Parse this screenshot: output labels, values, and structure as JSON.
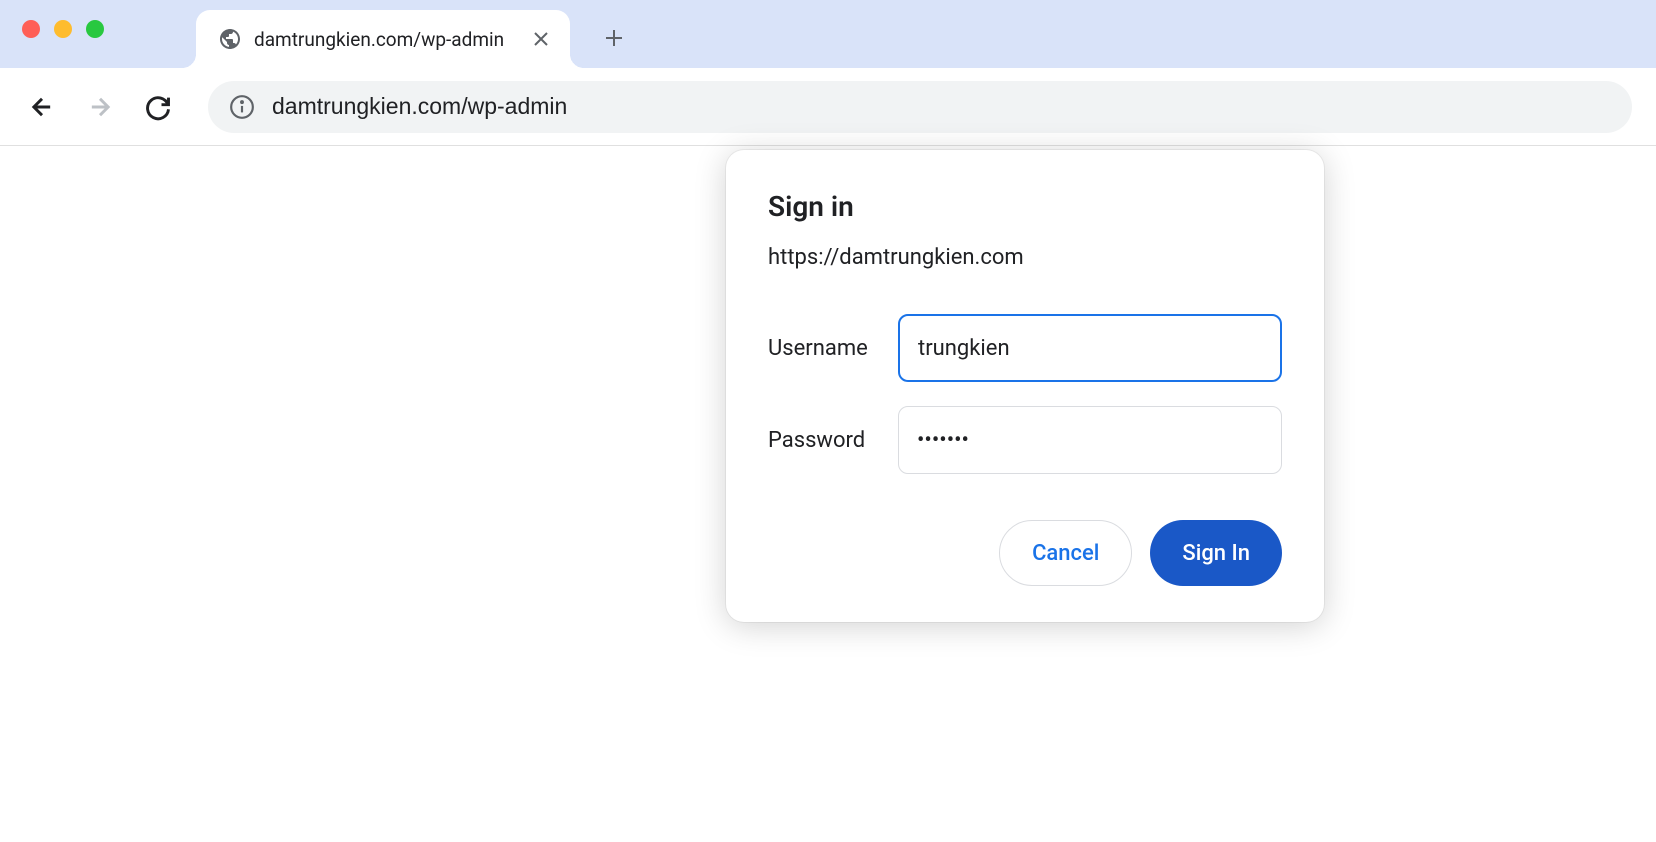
{
  "tab": {
    "title": "damtrungkien.com/wp-admin"
  },
  "address_bar": {
    "url": "damtrungkien.com/wp-admin"
  },
  "dialog": {
    "title": "Sign in",
    "origin": "https://damtrungkien.com",
    "username_label": "Username",
    "username_value": "trungkien",
    "password_label": "Password",
    "password_value": "•••••••",
    "cancel_label": "Cancel",
    "signin_label": "Sign In"
  }
}
